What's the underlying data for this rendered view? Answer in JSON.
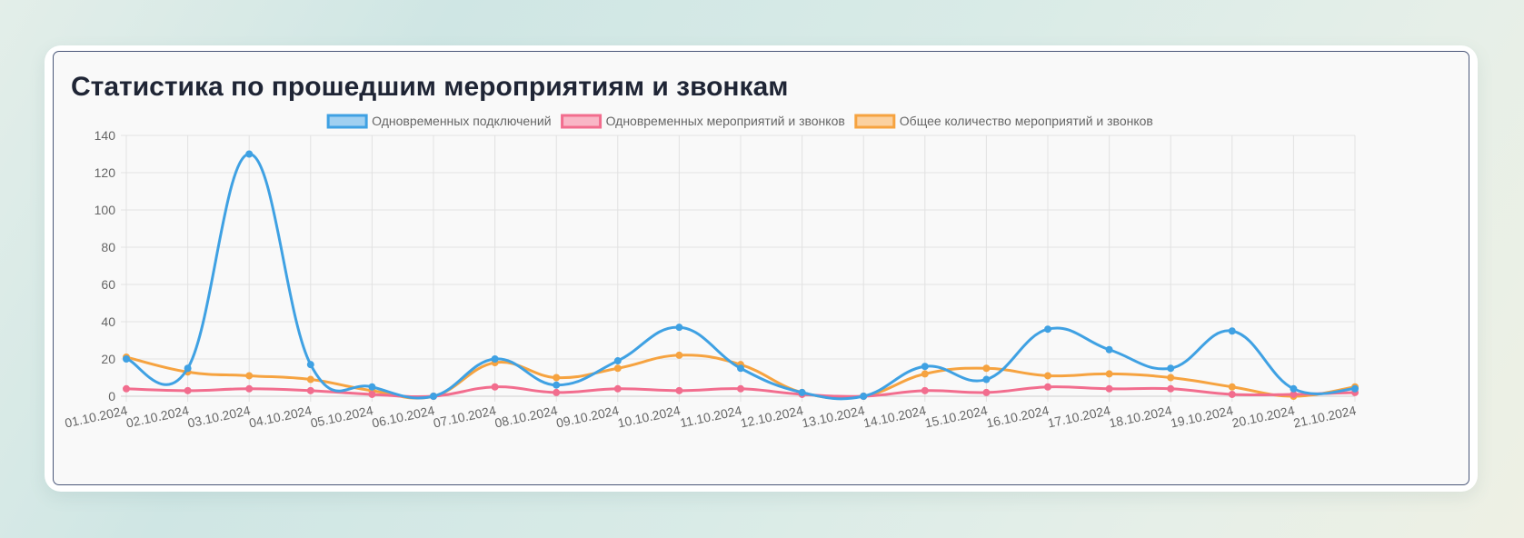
{
  "card": {
    "title": "Статистика по прошедшим мероприятиям и звонкам"
  },
  "chart_data": {
    "type": "line",
    "title": "",
    "xlabel": "",
    "ylabel": "",
    "ylim": [
      0,
      140
    ],
    "y_ticks": [
      0,
      20,
      40,
      60,
      80,
      100,
      120,
      140
    ],
    "grid": true,
    "legend_position": "top",
    "categories": [
      "01.10.2024",
      "02.10.2024",
      "03.10.2024",
      "04.10.2024",
      "05.10.2024",
      "06.10.2024",
      "07.10.2024",
      "08.10.2024",
      "09.10.2024",
      "10.10.2024",
      "11.10.2024",
      "12.10.2024",
      "13.10.2024",
      "14.10.2024",
      "15.10.2024",
      "16.10.2024",
      "17.10.2024",
      "18.10.2024",
      "19.10.2024",
      "20.10.2024",
      "21.10.2024"
    ],
    "series": [
      {
        "name": "Одновременных подключений",
        "color": "#3fa1e3",
        "fill": "#a0d0f1",
        "values": [
          20,
          15,
          130,
          17,
          5,
          0,
          20,
          6,
          19,
          37,
          15,
          2,
          0,
          16,
          9,
          36,
          25,
          15,
          35,
          4,
          4
        ]
      },
      {
        "name": "Одновременных мероприятий и звонков",
        "color": "#f26d8e",
        "fill": "#f9b6c6",
        "values": [
          4,
          3,
          4,
          3,
          1,
          0,
          5,
          2,
          4,
          3,
          4,
          1,
          0,
          3,
          2,
          5,
          4,
          4,
          1,
          1,
          2
        ]
      },
      {
        "name": "Общее количество мероприятий и звонков",
        "color": "#f6a340",
        "fill": "#fbd1a0",
        "values": [
          21,
          13,
          11,
          9,
          3,
          0,
          18,
          10,
          15,
          22,
          17,
          2,
          0,
          12,
          15,
          11,
          12,
          10,
          5,
          0,
          5
        ]
      }
    ]
  }
}
